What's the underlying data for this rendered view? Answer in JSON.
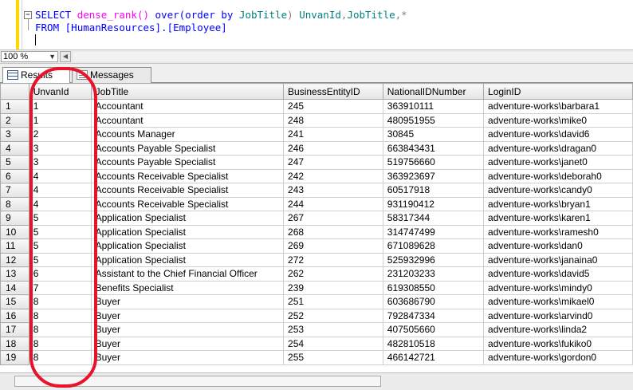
{
  "editor": {
    "line1": {
      "select": "SELECT",
      "fn": "dense_rank()",
      "over": "over(",
      "order": "order by",
      "col": "JobTitle",
      "close": ")",
      "alias": "UnvanId",
      "comma1": ",",
      "col2": "JobTitle",
      "comma2": ",",
      "star": "*"
    },
    "line2": {
      "from": "FROM",
      "obj": "[HumanResources].[Employee]"
    },
    "collapse_glyph": "−"
  },
  "zoom": {
    "value": "100 %",
    "arrow_glyph": "▼",
    "scroll_glyph": "◀"
  },
  "tabs": {
    "results": "Results",
    "messages": "Messages"
  },
  "grid": {
    "columns": [
      "UnvanId",
      "JobTitle",
      "BusinessEntityID",
      "NationalIDNumber",
      "LoginID"
    ],
    "rows": [
      [
        "1",
        "1",
        "Accountant",
        "245",
        "363910111",
        "adventure-works\\barbara1"
      ],
      [
        "2",
        "1",
        "Accountant",
        "248",
        "480951955",
        "adventure-works\\mike0"
      ],
      [
        "3",
        "2",
        "Accounts Manager",
        "241",
        "30845",
        "adventure-works\\david6"
      ],
      [
        "4",
        "3",
        "Accounts Payable Specialist",
        "246",
        "663843431",
        "adventure-works\\dragan0"
      ],
      [
        "5",
        "3",
        "Accounts Payable Specialist",
        "247",
        "519756660",
        "adventure-works\\janet0"
      ],
      [
        "6",
        "4",
        "Accounts Receivable Specialist",
        "242",
        "363923697",
        "adventure-works\\deborah0"
      ],
      [
        "7",
        "4",
        "Accounts Receivable Specialist",
        "243",
        "60517918",
        "adventure-works\\candy0"
      ],
      [
        "8",
        "4",
        "Accounts Receivable Specialist",
        "244",
        "931190412",
        "adventure-works\\bryan1"
      ],
      [
        "9",
        "5",
        "Application Specialist",
        "267",
        "58317344",
        "adventure-works\\karen1"
      ],
      [
        "10",
        "5",
        "Application Specialist",
        "268",
        "314747499",
        "adventure-works\\ramesh0"
      ],
      [
        "11",
        "5",
        "Application Specialist",
        "269",
        "671089628",
        "adventure-works\\dan0"
      ],
      [
        "12",
        "5",
        "Application Specialist",
        "272",
        "525932996",
        "adventure-works\\janaina0"
      ],
      [
        "13",
        "6",
        "Assistant to the Chief Financial Officer",
        "262",
        "231203233",
        "adventure-works\\david5"
      ],
      [
        "14",
        "7",
        "Benefits Specialist",
        "239",
        "619308550",
        "adventure-works\\mindy0"
      ],
      [
        "15",
        "8",
        "Buyer",
        "251",
        "603686790",
        "adventure-works\\mikael0"
      ],
      [
        "16",
        "8",
        "Buyer",
        "252",
        "792847334",
        "adventure-works\\arvind0"
      ],
      [
        "17",
        "8",
        "Buyer",
        "253",
        "407505660",
        "adventure-works\\linda2"
      ],
      [
        "18",
        "8",
        "Buyer",
        "254",
        "482810518",
        "adventure-works\\fukiko0"
      ],
      [
        "19",
        "8",
        "Buyer",
        "255",
        "466142721",
        "adventure-works\\gordon0"
      ]
    ]
  },
  "colors": {
    "annotation": "#e8132a",
    "keyword": "#0000ff",
    "function": "#ff00ff",
    "identifier": "#008080"
  }
}
